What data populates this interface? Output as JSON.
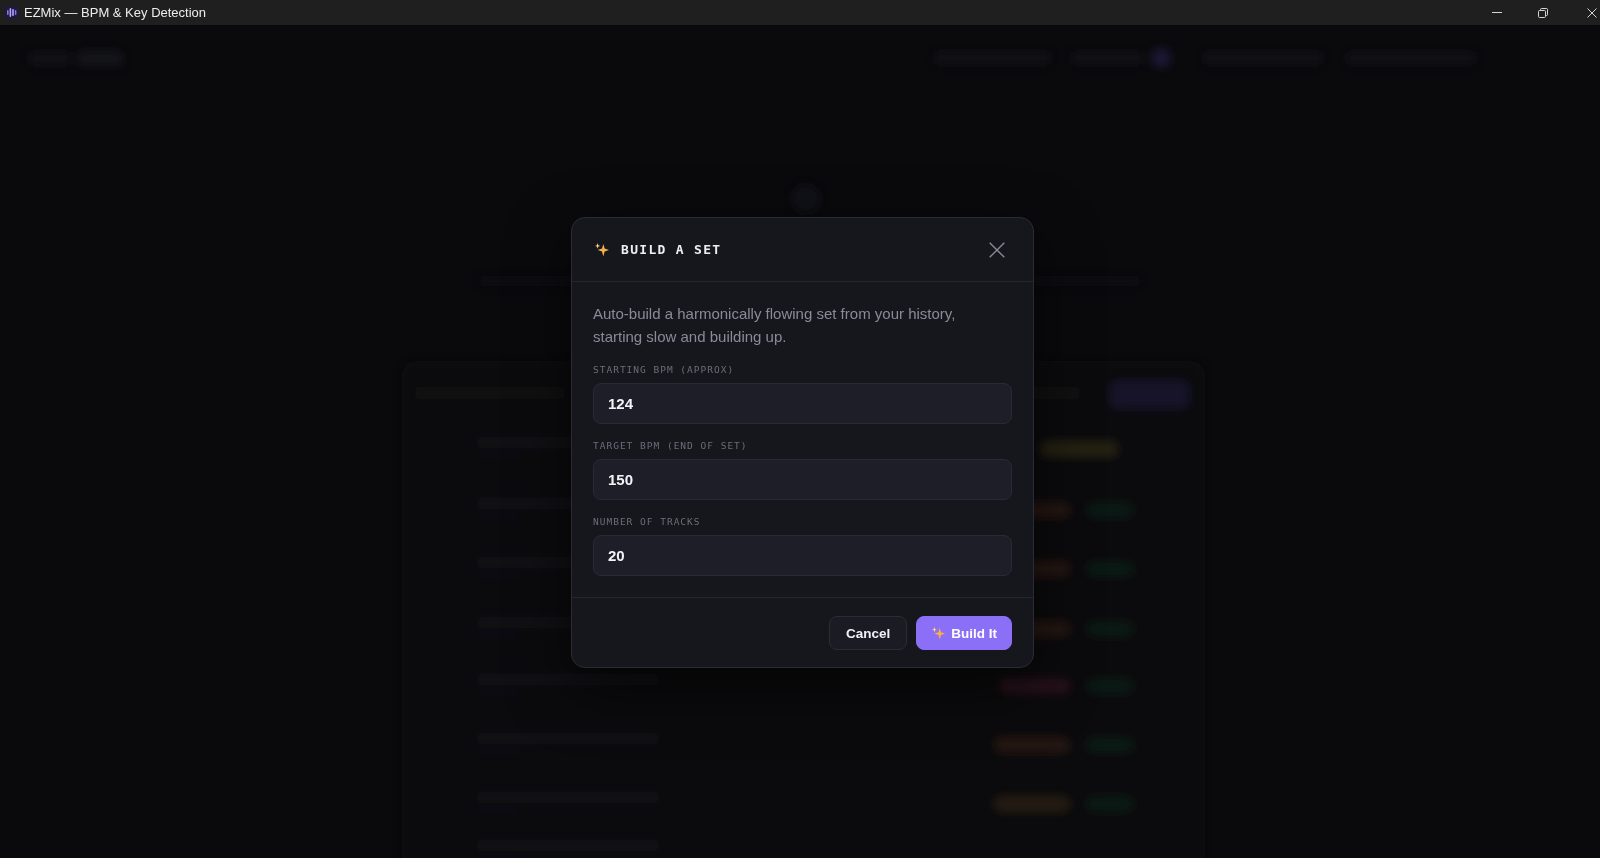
{
  "window": {
    "title": "EZMix — BPM & Key Detection"
  },
  "dialog": {
    "title": "BUILD A SET",
    "description": "Auto-build a harmonically flowing set from your history, starting slow and building up.",
    "fields": [
      {
        "label": "STARTING BPM (APPROX)",
        "value": "124"
      },
      {
        "label": "TARGET BPM (END OF SET)",
        "value": "150"
      },
      {
        "label": "NUMBER OF TRACKS",
        "value": "20"
      }
    ],
    "buttons": [
      {
        "label": "Cancel",
        "kind": "secondary"
      },
      {
        "label": "Build It",
        "kind": "primary"
      }
    ]
  }
}
